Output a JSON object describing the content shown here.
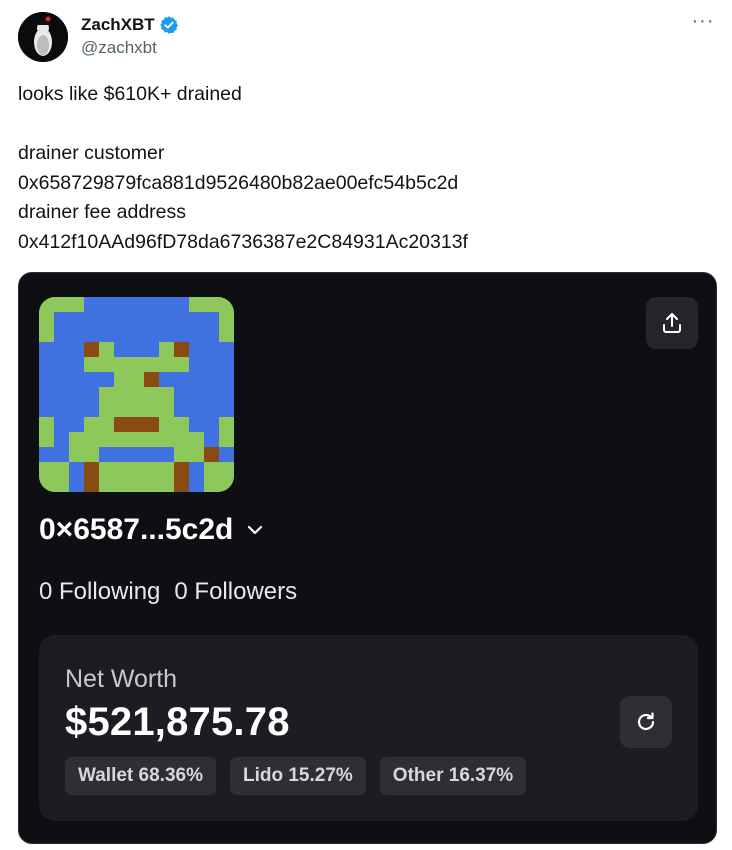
{
  "author": {
    "name": "ZachXBT",
    "handle": "@zachxbt",
    "verified_color": "#1d9bf0"
  },
  "more_icon": "more-horizontal-icon",
  "tweet": {
    "lines": [
      "looks like $610K+ drained",
      "",
      "drainer customer",
      "0x658729879fca881d9526480b82ae00efc54b5c2d",
      "drainer fee address",
      "0x412f10AAd96fD78da6736387e2C84931Ac20313f"
    ]
  },
  "card": {
    "share_icon": "share-upload-icon",
    "address_display": "0×6587...5c2d",
    "following": "0 Following",
    "followers": "0 Followers",
    "net_worth": {
      "label": "Net Worth",
      "value": "$521,875.78",
      "refresh_icon": "refresh-icon",
      "chips": [
        "Wallet 68.36%",
        "Lido 15.27%",
        "Other 16.37%"
      ]
    },
    "colors": {
      "background": "#0e0f12",
      "panel": "#1c1d22",
      "nft_blue": "#3f71e0",
      "nft_green": "#8fc85a",
      "nft_brown": "#8a4b12"
    }
  }
}
